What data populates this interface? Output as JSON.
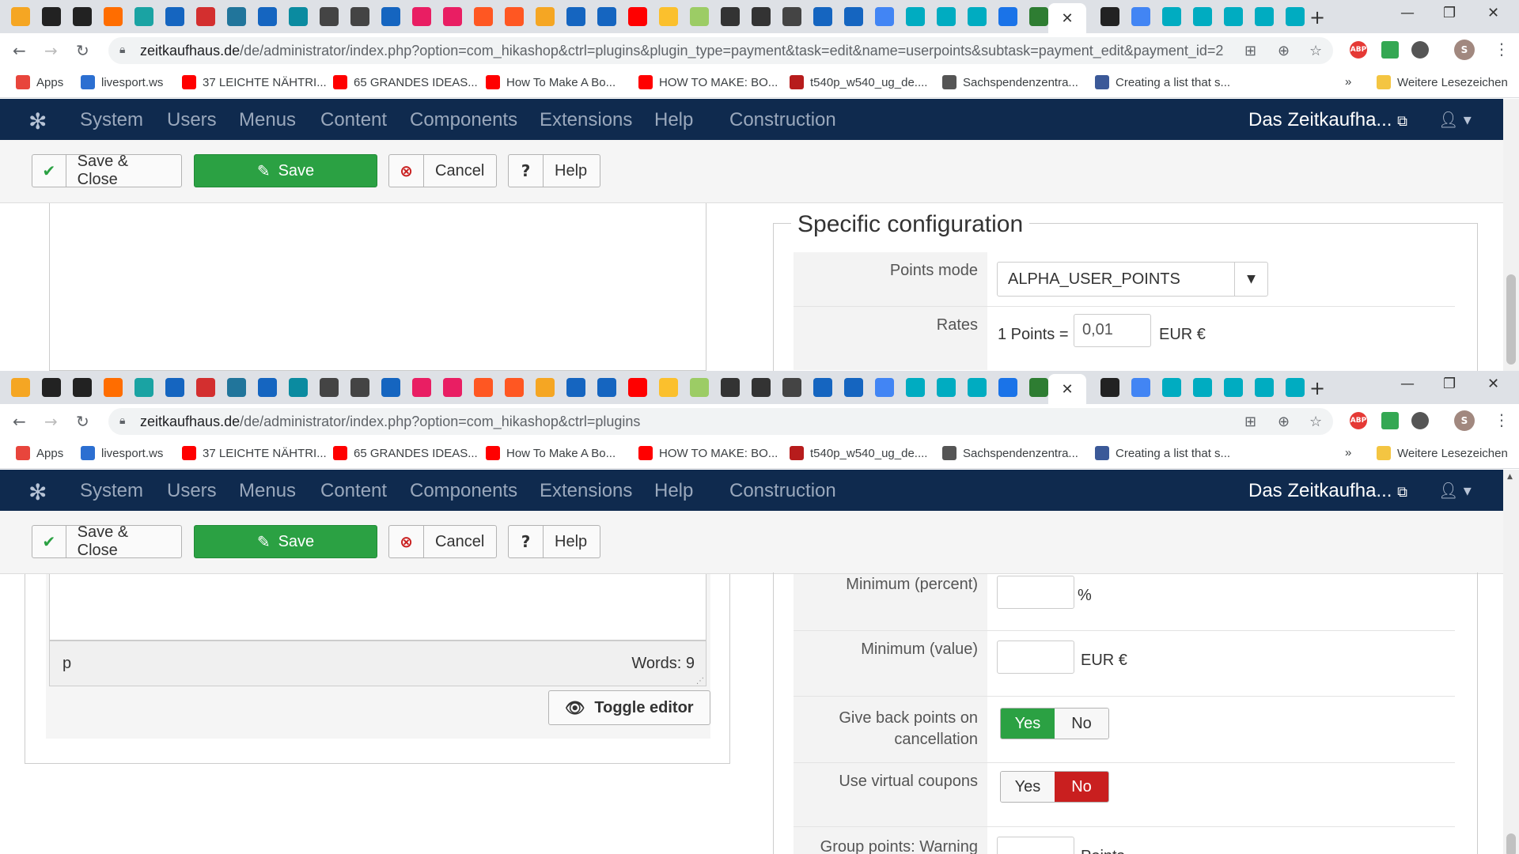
{
  "browser": {
    "active_tab_close": "✕",
    "new_tab": "+",
    "window_controls": [
      "—",
      "❐",
      "✕"
    ],
    "top_url": {
      "host": "zeitkaufhaus.de",
      "path": "/de/administrator/index.php?option=com_hikashop&ctrl=plugins&plugin_type=payment&task=edit&name=userpoints&subtask=payment_edit&payment_id=2"
    },
    "bottom_url": {
      "host": "zeitkaufhaus.de",
      "path": "/de/administrator/index.php?option=com_hikashop&ctrl=plugins"
    },
    "profile_initial": "S",
    "abp_label": "ABP",
    "bookmarks": [
      {
        "label": "Apps",
        "icon": "apps-grid-icon",
        "color": "#e8453c"
      },
      {
        "label": "livesport.ws",
        "icon": "livesport-icon",
        "color": "#2c6fd1"
      },
      {
        "label": "37 LEICHTE NÄHTRI...",
        "icon": "youtube-icon",
        "color": "#ff0000"
      },
      {
        "label": "65 GRANDES IDEAS...",
        "icon": "youtube-icon",
        "color": "#ff0000"
      },
      {
        "label": "How To Make A Bo...",
        "icon": "youtube-icon",
        "color": "#ff0000"
      },
      {
        "label": "HOW TO MAKE: BO...",
        "icon": "youtube-icon",
        "color": "#ff0000"
      },
      {
        "label": "t540p_w540_ug_de....",
        "icon": "pdf-icon",
        "color": "#b71c1c"
      },
      {
        "label": "Sachspendenzentra...",
        "icon": "globe-icon",
        "color": "#555555"
      },
      {
        "label": "Creating a list that s...",
        "icon": "globe-icon",
        "color": "#3b5998"
      }
    ],
    "bookmarks_more": "»",
    "other_bookmarks": "Weitere Lesezeichen"
  },
  "joomla": {
    "menu": [
      "System",
      "Users",
      "Menus",
      "Content",
      "Components",
      "Extensions",
      "Help",
      "Construction"
    ],
    "site_name": "Das Zeitkaufha...",
    "toolbar": {
      "save_close": "Save & Close",
      "save": "Save",
      "cancel": "Cancel",
      "help": "Help"
    }
  },
  "top_pane": {
    "legend": "Specific configuration",
    "points_mode_label": "Points mode",
    "points_mode_value": "ALPHA_USER_POINTS",
    "rates_label": "Rates",
    "rates_prefix": "1 Points =",
    "rates_value": "0,01",
    "rates_unit": "EUR €"
  },
  "bottom_pane": {
    "editor_path": "p",
    "word_count": "Words: 9",
    "toggle_editor": "Toggle editor",
    "minimum_percent_label": "Minimum (percent)",
    "minimum_percent_unit": "%",
    "minimum_value_label": "Minimum (value)",
    "minimum_value_unit": "EUR €",
    "give_back_label": "Give back points on cancellation",
    "give_back_value": "Yes",
    "virtual_coupons_label": "Use virtual coupons",
    "virtual_coupons_value": "No",
    "group_points_label": "Group points: Warning level",
    "group_points_unit": "Points",
    "yes_label": "Yes",
    "no_label": "No"
  }
}
